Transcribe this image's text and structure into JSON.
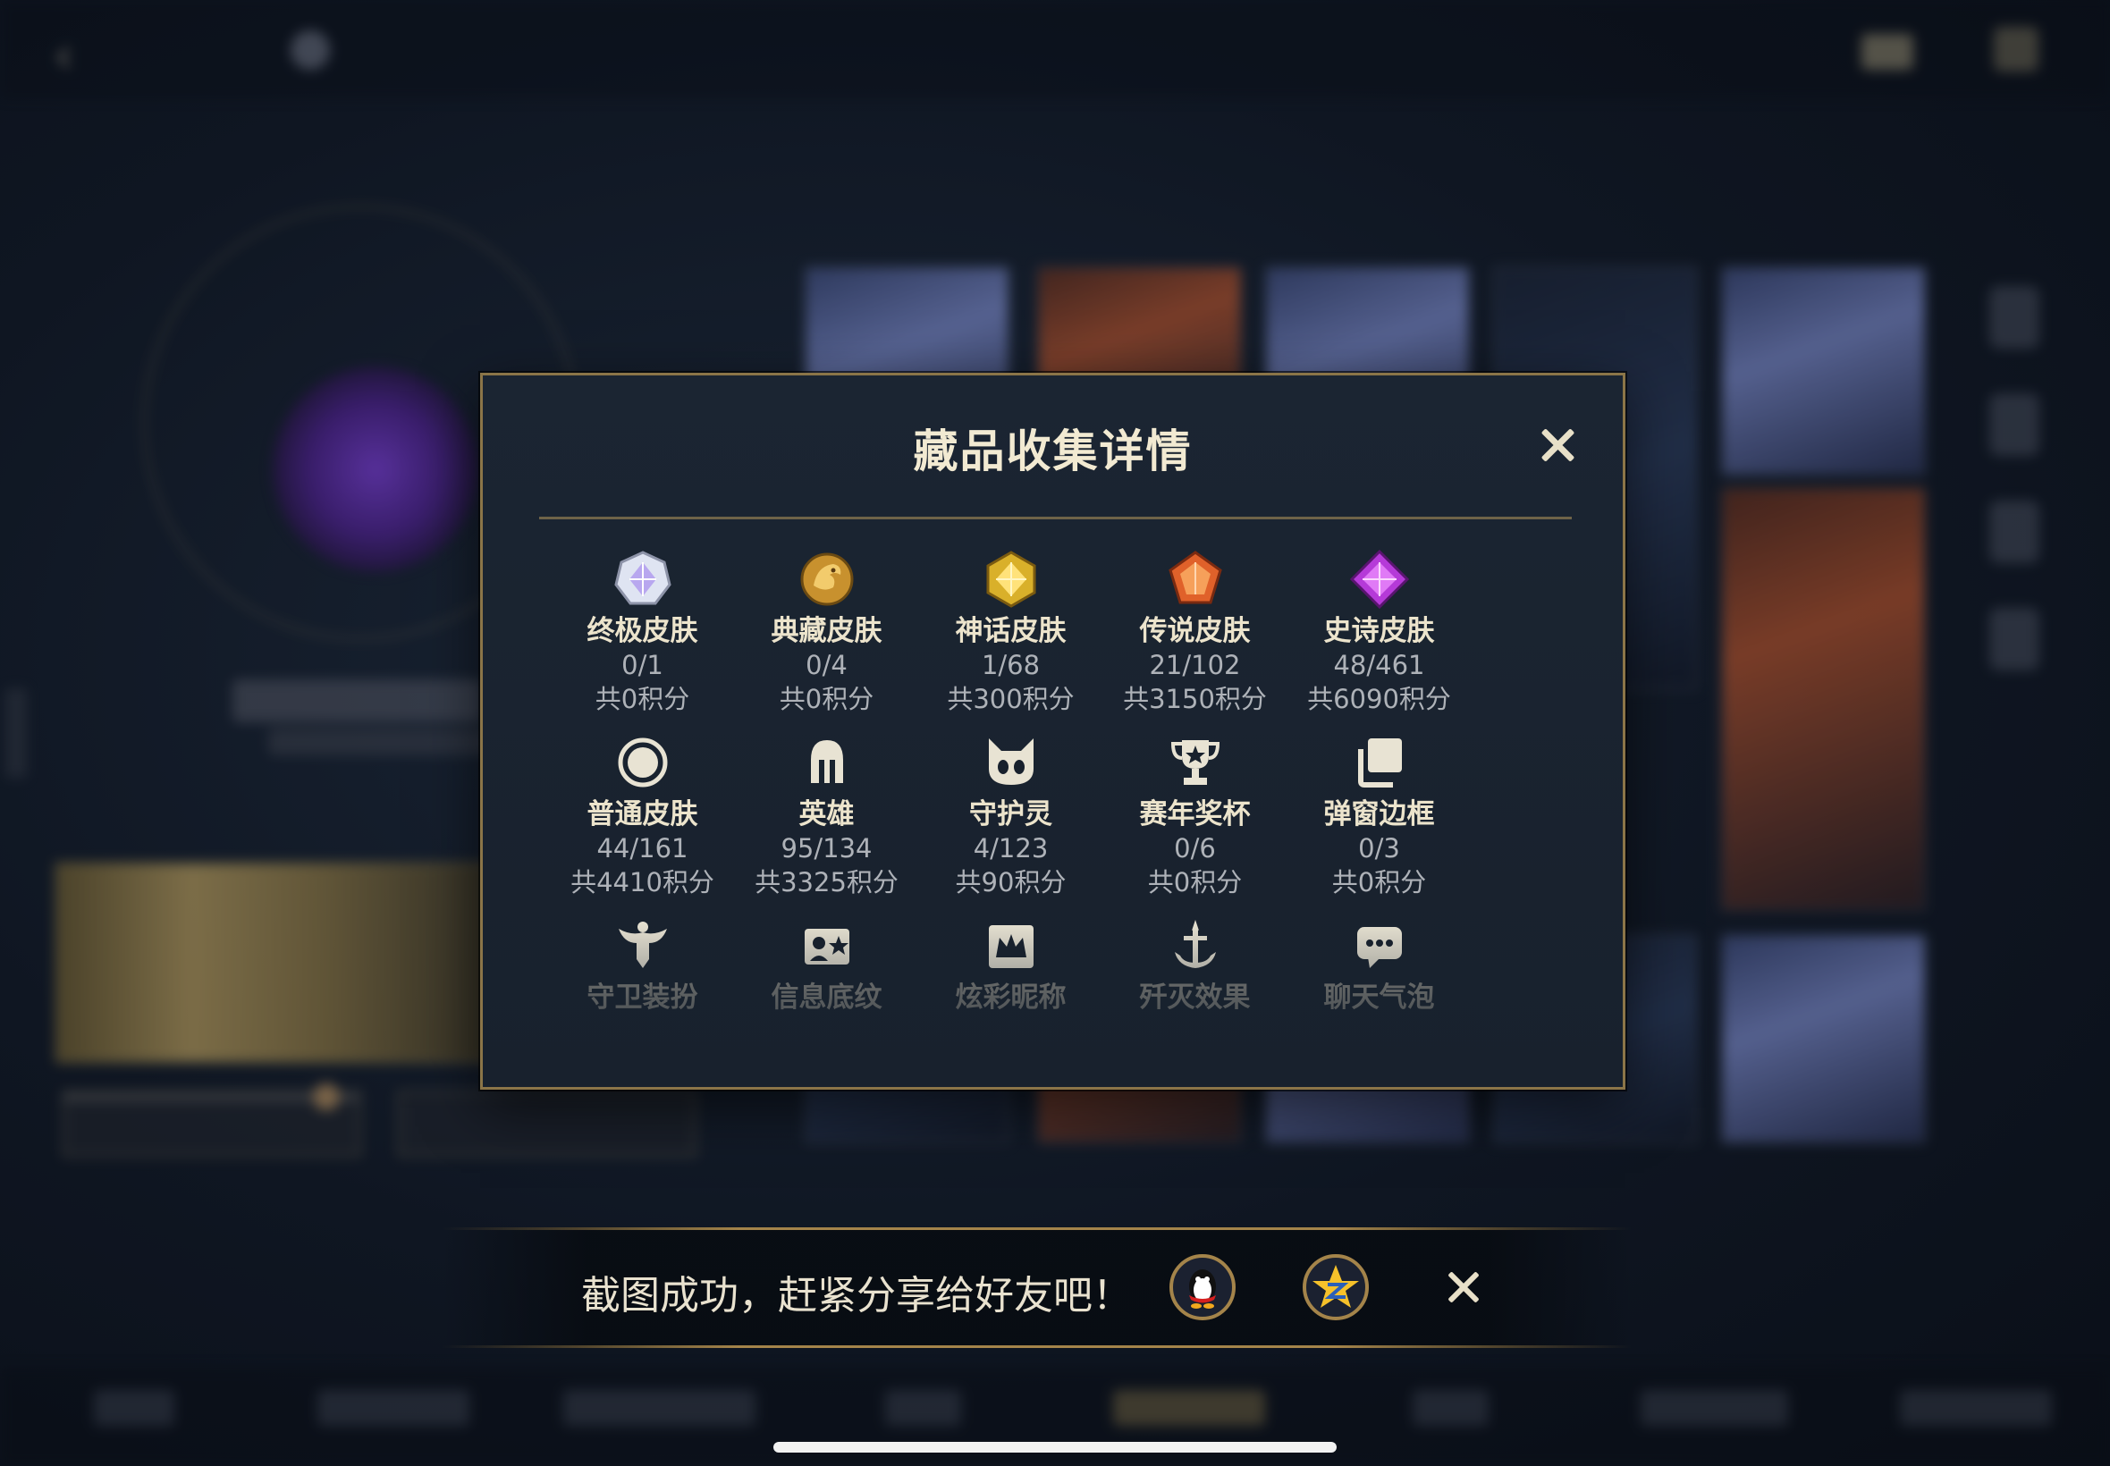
{
  "modal": {
    "title": "藏品收集详情",
    "close_label": "×",
    "items": [
      {
        "name": "终极皮肤",
        "count": "0/1",
        "points": "共0积分",
        "icon": "ultimate-skin-gem-icon"
      },
      {
        "name": "典藏皮肤",
        "count": "0/4",
        "points": "共0积分",
        "icon": "collector-skin-dragon-icon"
      },
      {
        "name": "神话皮肤",
        "count": "1/68",
        "points": "共300积分",
        "icon": "mythic-skin-gem-icon"
      },
      {
        "name": "传说皮肤",
        "count": "21/102",
        "points": "共3150积分",
        "icon": "legendary-skin-gem-icon"
      },
      {
        "name": "史诗皮肤",
        "count": "48/461",
        "points": "共6090积分",
        "icon": "epic-skin-gem-icon"
      },
      {
        "name": "普通皮肤",
        "count": "44/161",
        "points": "共4410积分",
        "icon": "normal-skin-ring-icon"
      },
      {
        "name": "英雄",
        "count": "95/134",
        "points": "共3325积分",
        "icon": "hero-helmet-icon"
      },
      {
        "name": "守护灵",
        "count": "4/123",
        "points": "共90积分",
        "icon": "guardian-spirit-icon"
      },
      {
        "name": "赛年奖杯",
        "count": "0/6",
        "points": "共0积分",
        "icon": "season-trophy-icon"
      },
      {
        "name": "弹窗边框",
        "count": "0/3",
        "points": "共0积分",
        "icon": "popup-frame-icon"
      },
      {
        "name": "守卫装扮",
        "count": "",
        "points": "",
        "icon": "guard-outfit-icon"
      },
      {
        "name": "信息底纹",
        "count": "",
        "points": "",
        "icon": "info-background-icon"
      },
      {
        "name": "炫彩昵称",
        "count": "",
        "points": "",
        "icon": "colorful-nickname-icon"
      },
      {
        "name": "歼灭效果",
        "count": "",
        "points": "",
        "icon": "elimination-effect-icon"
      },
      {
        "name": "聊天气泡",
        "count": "",
        "points": "",
        "icon": "chat-bubble-icon"
      }
    ]
  },
  "share_bar": {
    "text": "截图成功，赶紧分享给好友吧！",
    "buttons": [
      "qq-share-icon",
      "qzone-share-icon"
    ],
    "close_label": "×"
  },
  "colors": {
    "accent_gold": "#a4844a",
    "modal_bg": "#18212d",
    "text_primary": "#ece4cc",
    "text_secondary": "#aeb2b8"
  }
}
